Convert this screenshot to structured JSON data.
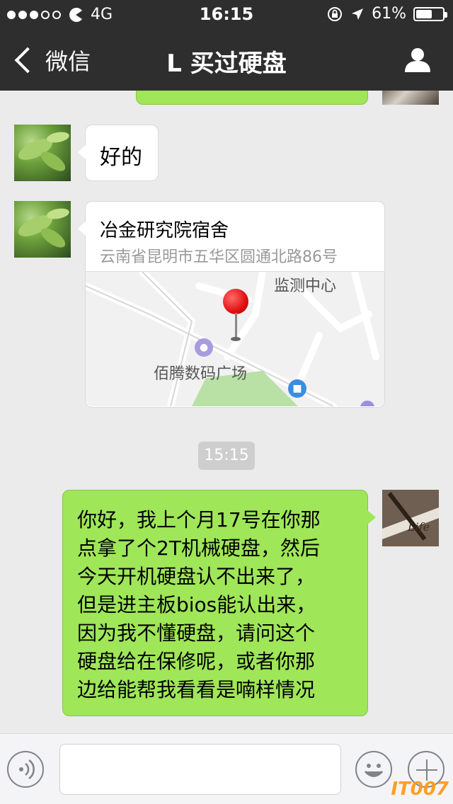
{
  "status_bar": {
    "network": "4G",
    "time": "16:15",
    "battery_percent": "61%",
    "battery_level": 0.61,
    "signal_filled": 3,
    "signal_total": 5
  },
  "nav": {
    "back_label": "微信",
    "title": "L  买过硬盘",
    "profile_icon": "person-icon"
  },
  "messages": {
    "ok": "好的",
    "location": {
      "title": "冶金研究院宿舍",
      "address": "云南省昆明市五华区圆通北路86号",
      "map_labels": {
        "top": "监测中心",
        "plaza": "佰腾数码广场"
      }
    },
    "timestamp": "15:15",
    "long_message_lines": [
      "你好，我上个月17号在你那",
      "点拿了个2T机械硬盘，然后",
      "今天开机硬盘认不出来了，",
      "但是进主板bios能认出来，",
      "因为我不懂硬盘，请问这个",
      "硬盘给在保修呢，或者你那",
      "边给能帮我看看是喃样情况"
    ]
  },
  "input_bar": {
    "voice_icon": "voice-icon",
    "emoji_icon": "emoji-icon",
    "plus_icon": "plus-icon"
  },
  "watermark": "IT007",
  "avatar_self_text": "Life",
  "colors": {
    "bar": "#2e2e2e",
    "bubble_green": "#9fe658",
    "background": "#ebebeb"
  }
}
